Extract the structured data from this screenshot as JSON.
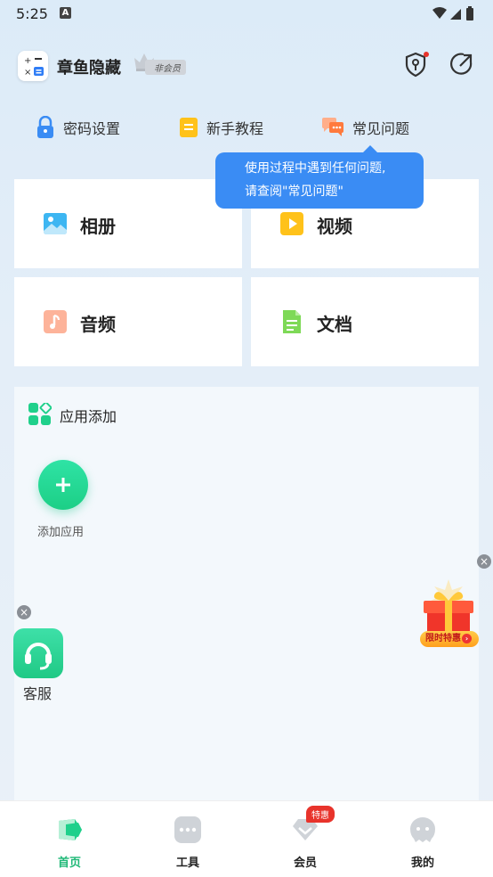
{
  "status": {
    "time": "5:25",
    "notif": "A"
  },
  "header": {
    "title": "章鱼隐藏",
    "member_tag": "非会员"
  },
  "quick": [
    {
      "label": "密码设置",
      "icon": "lock-icon"
    },
    {
      "label": "新手教程",
      "icon": "notebook-icon"
    },
    {
      "label": "常见问题",
      "icon": "chat-bubbles-icon"
    }
  ],
  "tooltip": {
    "line1": "使用过程中遇到任何问题,",
    "line2": "请查阅\"常见问题\""
  },
  "cards": [
    {
      "label": "相册",
      "icon": "photo-icon"
    },
    {
      "label": "视频",
      "icon": "video-play-icon"
    },
    {
      "label": "音频",
      "icon": "music-note-icon"
    },
    {
      "label": "文档",
      "icon": "document-icon"
    }
  ],
  "apps": {
    "title": "应用添加",
    "add_label": "添加应用"
  },
  "customer_service": {
    "label": "客服"
  },
  "promo": {
    "label": "限时特惠"
  },
  "tabs": [
    {
      "label": "首页",
      "active": true
    },
    {
      "label": "工具"
    },
    {
      "label": "会员",
      "badge": "特惠"
    },
    {
      "label": "我的"
    }
  ],
  "colors": {
    "accent_green": "#1fd08b",
    "tooltip_blue": "#3a8cf4",
    "badge_red": "#e8332b"
  }
}
